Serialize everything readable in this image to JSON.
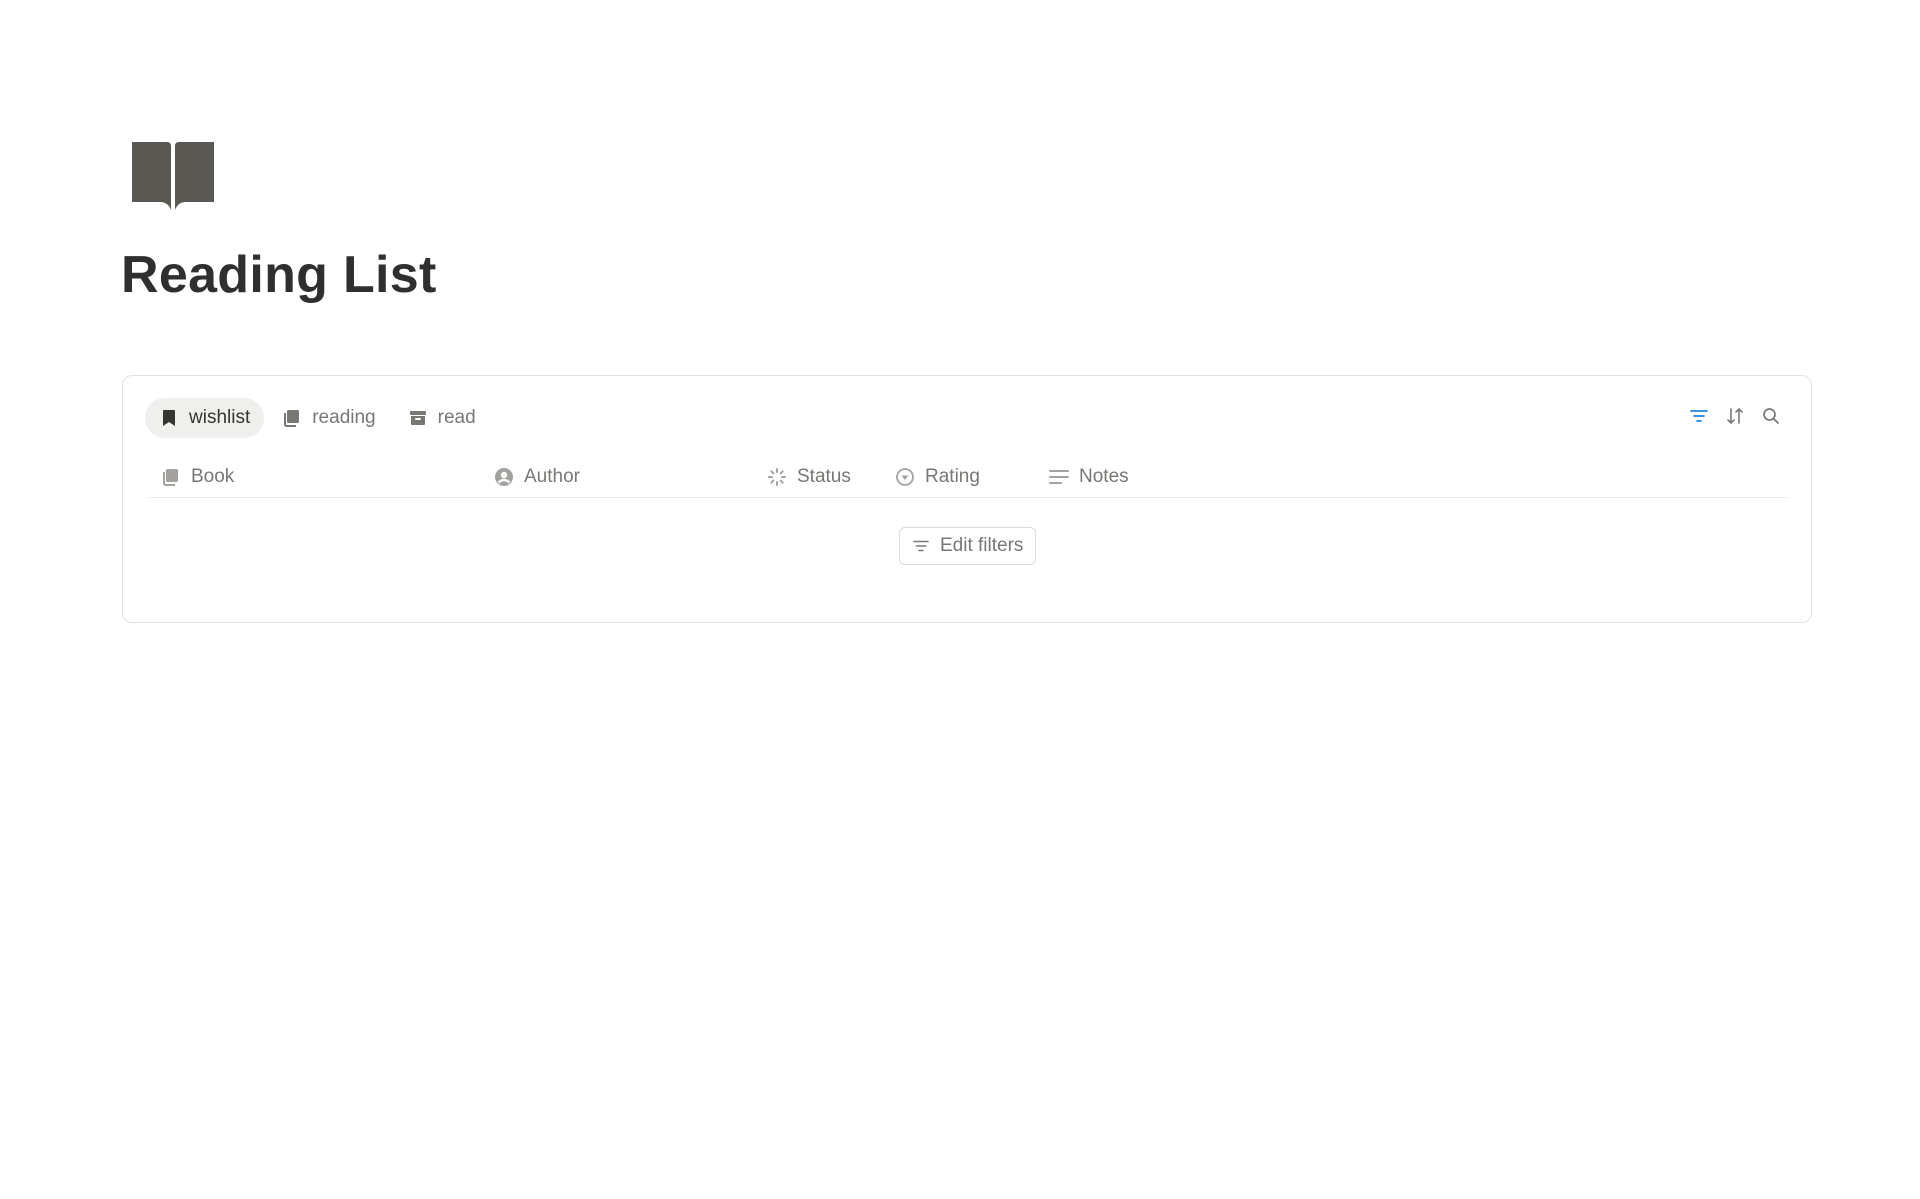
{
  "page": {
    "icon": "open-book-icon",
    "title": "Reading List"
  },
  "database": {
    "tabs": [
      {
        "label": "wishlist",
        "icon": "bookmark-icon",
        "active": true
      },
      {
        "label": "reading",
        "icon": "book-icon",
        "active": false
      },
      {
        "label": "read",
        "icon": "archive-icon",
        "active": false
      }
    ],
    "toolbar": [
      {
        "icon": "filter-icon",
        "color": "#2383e2"
      },
      {
        "icon": "sort-icon",
        "color": "#787774"
      },
      {
        "icon": "search-icon",
        "color": "#787774"
      }
    ],
    "columns": [
      {
        "label": "Book",
        "icon": "book-icon"
      },
      {
        "label": "Author",
        "icon": "person-icon"
      },
      {
        "label": "Status",
        "icon": "status-icon"
      },
      {
        "label": "Rating",
        "icon": "select-icon"
      },
      {
        "label": "Notes",
        "icon": "text-icon"
      }
    ],
    "empty_action": {
      "label": "Edit filters",
      "icon": "filter-icon"
    }
  },
  "colors": {
    "text": "#37352f",
    "muted": "#787774",
    "accent": "#2383e2",
    "icon_dark": "#5a5852"
  }
}
